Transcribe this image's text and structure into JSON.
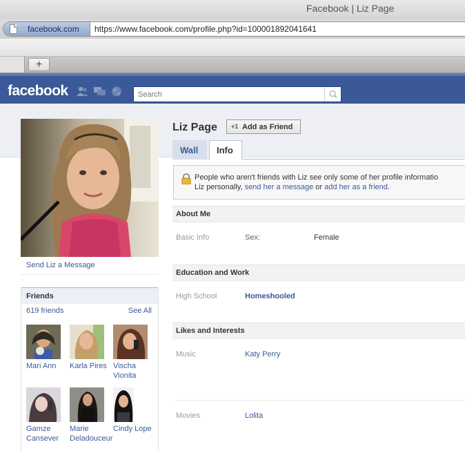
{
  "browser": {
    "window_title": "Facebook | Liz Page",
    "site_badge": "facebook.com",
    "url": "https://www.facebook.com/profile.php?id=100001892041641",
    "new_tab_label": "+"
  },
  "header": {
    "logo": "facebook",
    "search_placeholder": "Search",
    "icons": [
      "friends-icon",
      "messages-icon",
      "globe-icon",
      "magnifier-icon"
    ],
    "brand_color": "#3b5998"
  },
  "profile": {
    "name": "Liz Page",
    "add_friend_plus": "+1",
    "add_friend_label": "Add as Friend",
    "send_message": "Send Liz a Message"
  },
  "tabs": [
    {
      "label": "Wall",
      "active": false
    },
    {
      "label": "Info",
      "active": true
    }
  ],
  "notice": {
    "line1": "People who aren't friends with Liz see only some of her profile informatio",
    "line2_pre": "Liz personally, ",
    "link1": "send her a message",
    "line2_mid": " or ",
    "link2": "add her as a friend",
    "line2_end": "."
  },
  "friends": {
    "title": "Friends",
    "count": "619 friends",
    "see_all": "See All",
    "list": [
      {
        "name": "Mari Ann"
      },
      {
        "name": "Karla Pires"
      },
      {
        "name": "Vischa Vionita"
      },
      {
        "name": "Gamze Cansever"
      },
      {
        "name": "Marie Deladouceur"
      },
      {
        "name": "Cindy Lope"
      }
    ]
  },
  "info": {
    "about_me": {
      "title": "About Me",
      "basic_info_label": "Basic Info",
      "sex_label": "Sex:",
      "sex_value": "Female"
    },
    "education": {
      "title": "Education and Work",
      "high_school_label": "High School",
      "high_school_value": "Homeshooled"
    },
    "likes": {
      "title": "Likes and Interests",
      "music_label": "Music",
      "music_value": "Katy Perry",
      "movies_label": "Movies",
      "movies_value": "Lolita"
    }
  }
}
